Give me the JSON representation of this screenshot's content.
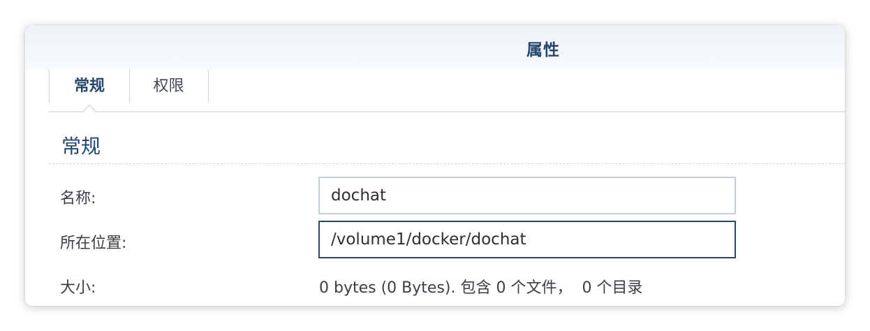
{
  "window": {
    "title": "属性"
  },
  "tabs": [
    {
      "label": "常规",
      "active": true
    },
    {
      "label": "权限",
      "active": false
    }
  ],
  "section": {
    "title": "常规"
  },
  "fields": {
    "name": {
      "label": "名称:",
      "value": "dochat"
    },
    "location": {
      "label": "所在位置:",
      "value": "/volume1/docker/dochat"
    },
    "size": {
      "label": "大小:",
      "value": "0 bytes (0 Bytes). 包含 0 个文件，  0 个目录"
    }
  },
  "colors": {
    "accent": "#24466f",
    "tab_border": "#cfd8e3",
    "field_border": "#c6cfd9",
    "focused_field_border": "#24466f"
  }
}
